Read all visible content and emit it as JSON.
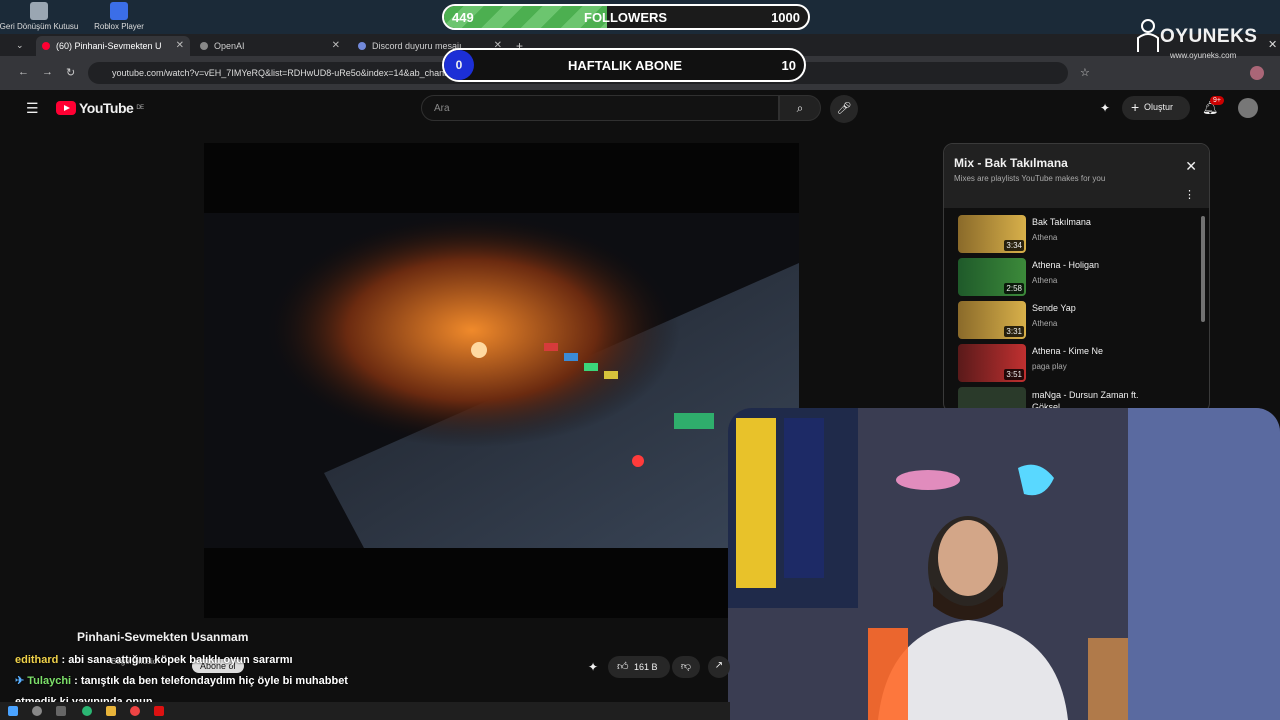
{
  "desktop": {
    "icons": [
      {
        "label": "Geri Dönüşüm Kutusu",
        "icon": "recycle-bin-icon"
      },
      {
        "label": "Roblox Player",
        "icon": "roblox-icon"
      }
    ]
  },
  "browser": {
    "tabs": [
      {
        "label": "(60) Pinhani-Sevmekten U",
        "active": true
      },
      {
        "label": "OpenAI",
        "active": false
      },
      {
        "label": "Discord duyuru mesajı",
        "active": false
      }
    ],
    "url": "youtube.com/watch?v=vEH_7IMYeRQ&list=RDHwUD8-uRe5o&index=14&ab_channel=BegeniMusic"
  },
  "youtube": {
    "logo_text": "YouTube",
    "region": "DE",
    "search_placeholder": "Ara",
    "create_label": "Oluştur",
    "notif_count": "9+",
    "video_title": "Pinhani-Sevmekten Usanmam",
    "channel": "BegeniMusic",
    "subscribe_label": "Abone ol",
    "like_count": "161 B"
  },
  "playlist": {
    "title": "Mix - Bak Takılmana",
    "subtitle": "Mixes are playlists YouTube makes for you",
    "items": [
      {
        "title": "Bak Takılmana",
        "channel": "Athena",
        "duration": "3:34"
      },
      {
        "title": "Athena - Holigan",
        "channel": "Athena",
        "duration": "2:58"
      },
      {
        "title": "Sende Yap",
        "channel": "Athena",
        "duration": "3:31"
      },
      {
        "title": "Athena - Kime Ne",
        "channel": "paga play",
        "duration": "3:51"
      },
      {
        "title": "maNga - Dursun Zaman ft. Göksel",
        "channel": "",
        "duration": ""
      }
    ]
  },
  "overlay": {
    "followers": {
      "current": "449",
      "label": "FOLLOWERS",
      "goal": "1000",
      "progress": 0.449
    },
    "weekly": {
      "current": "0",
      "label": "HAFTALIK ABONE",
      "goal": "10"
    },
    "brand": {
      "name": "OYUNEKS",
      "site": "www.oyuneks.com"
    }
  },
  "chat": [
    {
      "user": "edithard",
      "message": ": abi sana attığım köpek balıklı oyun sararmı"
    },
    {
      "user": "Tulaychi",
      "message": ": tanıştık da ben telefondaydım hiç öyle bi muhabbet"
    },
    {
      "user": "",
      "message": "etmedik ki yayınında onun"
    }
  ],
  "colors": {
    "yt_red": "#ff0033",
    "followers_green": "#4caf50",
    "weekly_blue": "#1c2fd6"
  }
}
